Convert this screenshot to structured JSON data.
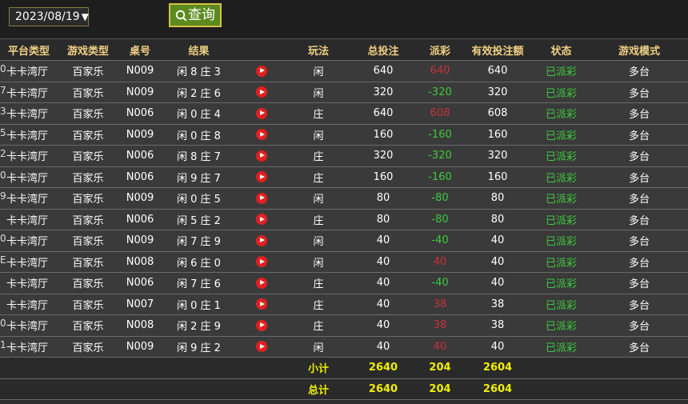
{
  "filter": {
    "date": "2023/08/19",
    "query_label": "查询"
  },
  "table": {
    "headers": [
      "平台类型",
      "游戏类型",
      "桌号",
      "结果",
      "",
      "玩法",
      "总投注",
      "派彩",
      "有效投注额",
      "状态",
      "游戏模式"
    ],
    "rows": [
      {
        "edge": "0",
        "platform": "卡卡湾厅",
        "game": "百家乐",
        "table": "N009",
        "result": "闲 8 庄 3",
        "bet_type": "闲",
        "total": "640",
        "payout": "640",
        "payout_sign": "pos",
        "valid": "640",
        "status": "已派彩",
        "mode": "多台"
      },
      {
        "edge": "7",
        "platform": "卡卡湾厅",
        "game": "百家乐",
        "table": "N009",
        "result": "闲 2 庄 6",
        "bet_type": "闲",
        "total": "320",
        "payout": "-320",
        "payout_sign": "neg",
        "valid": "320",
        "status": "已派彩",
        "mode": "多台"
      },
      {
        "edge": "3",
        "platform": "卡卡湾厅",
        "game": "百家乐",
        "table": "N006",
        "result": "闲 0 庄 4",
        "bet_type": "庄",
        "total": "640",
        "payout": "608",
        "payout_sign": "pos",
        "valid": "608",
        "status": "已派彩",
        "mode": "多台"
      },
      {
        "edge": "5",
        "platform": "卡卡湾厅",
        "game": "百家乐",
        "table": "N009",
        "result": "闲 0 庄 8",
        "bet_type": "闲",
        "total": "160",
        "payout": "-160",
        "payout_sign": "neg",
        "valid": "160",
        "status": "已派彩",
        "mode": "多台"
      },
      {
        "edge": "2",
        "platform": "卡卡湾厅",
        "game": "百家乐",
        "table": "N006",
        "result": "闲 8 庄 7",
        "bet_type": "庄",
        "total": "320",
        "payout": "-320",
        "payout_sign": "neg",
        "valid": "320",
        "status": "已派彩",
        "mode": "多台"
      },
      {
        "edge": "0",
        "platform": "卡卡湾厅",
        "game": "百家乐",
        "table": "N006",
        "result": "闲 9 庄 7",
        "bet_type": "庄",
        "total": "160",
        "payout": "-160",
        "payout_sign": "neg",
        "valid": "160",
        "status": "已派彩",
        "mode": "多台"
      },
      {
        "edge": "9",
        "platform": "卡卡湾厅",
        "game": "百家乐",
        "table": "N009",
        "result": "闲 0 庄 5",
        "bet_type": "闲",
        "total": "80",
        "payout": "-80",
        "payout_sign": "neg",
        "valid": "80",
        "status": "已派彩",
        "mode": "多台"
      },
      {
        "edge": "",
        "platform": "卡卡湾厅",
        "game": "百家乐",
        "table": "N006",
        "result": "闲 5 庄 2",
        "bet_type": "庄",
        "total": "80",
        "payout": "-80",
        "payout_sign": "neg",
        "valid": "80",
        "status": "已派彩",
        "mode": "多台"
      },
      {
        "edge": "0",
        "platform": "卡卡湾厅",
        "game": "百家乐",
        "table": "N009",
        "result": "闲 7 庄 9",
        "bet_type": "闲",
        "total": "40",
        "payout": "-40",
        "payout_sign": "neg",
        "valid": "40",
        "status": "已派彩",
        "mode": "多台"
      },
      {
        "edge": "E",
        "platform": "卡卡湾厅",
        "game": "百家乐",
        "table": "N008",
        "result": "闲 6 庄 0",
        "bet_type": "闲",
        "total": "40",
        "payout": "40",
        "payout_sign": "pos",
        "valid": "40",
        "status": "已派彩",
        "mode": "多台"
      },
      {
        "edge": "",
        "platform": "卡卡湾厅",
        "game": "百家乐",
        "table": "N006",
        "result": "闲 7 庄 6",
        "bet_type": "庄",
        "total": "40",
        "payout": "-40",
        "payout_sign": "neg",
        "valid": "40",
        "status": "已派彩",
        "mode": "多台"
      },
      {
        "edge": "",
        "platform": "卡卡湾厅",
        "game": "百家乐",
        "table": "N007",
        "result": "闲 0 庄 1",
        "bet_type": "庄",
        "total": "40",
        "payout": "38",
        "payout_sign": "pos",
        "valid": "38",
        "status": "已派彩",
        "mode": "多台"
      },
      {
        "edge": "0",
        "platform": "卡卡湾厅",
        "game": "百家乐",
        "table": "N008",
        "result": "闲 2 庄 9",
        "bet_type": "庄",
        "total": "40",
        "payout": "38",
        "payout_sign": "pos",
        "valid": "38",
        "status": "已派彩",
        "mode": "多台"
      },
      {
        "edge": "1",
        "platform": "卡卡湾厅",
        "game": "百家乐",
        "table": "N009",
        "result": "闲 9 庄 2",
        "bet_type": "闲",
        "total": "40",
        "payout": "40",
        "payout_sign": "pos",
        "valid": "40",
        "status": "已派彩",
        "mode": "多台"
      }
    ],
    "subtotal": {
      "label": "小计",
      "total": "2640",
      "payout": "204",
      "valid": "2604"
    },
    "grandtotal": {
      "label": "总计",
      "total": "2640",
      "payout": "204",
      "valid": "2604"
    }
  },
  "colors": {
    "header_text": "#f0d083",
    "positive_payout": "#c8333a",
    "negative_payout": "#3ec93e",
    "status": "#3ec93e",
    "totals": "#f0f000",
    "play_icon": "#e31f1f"
  },
  "icons": {
    "query": "search-icon",
    "row_action": "play-icon"
  }
}
